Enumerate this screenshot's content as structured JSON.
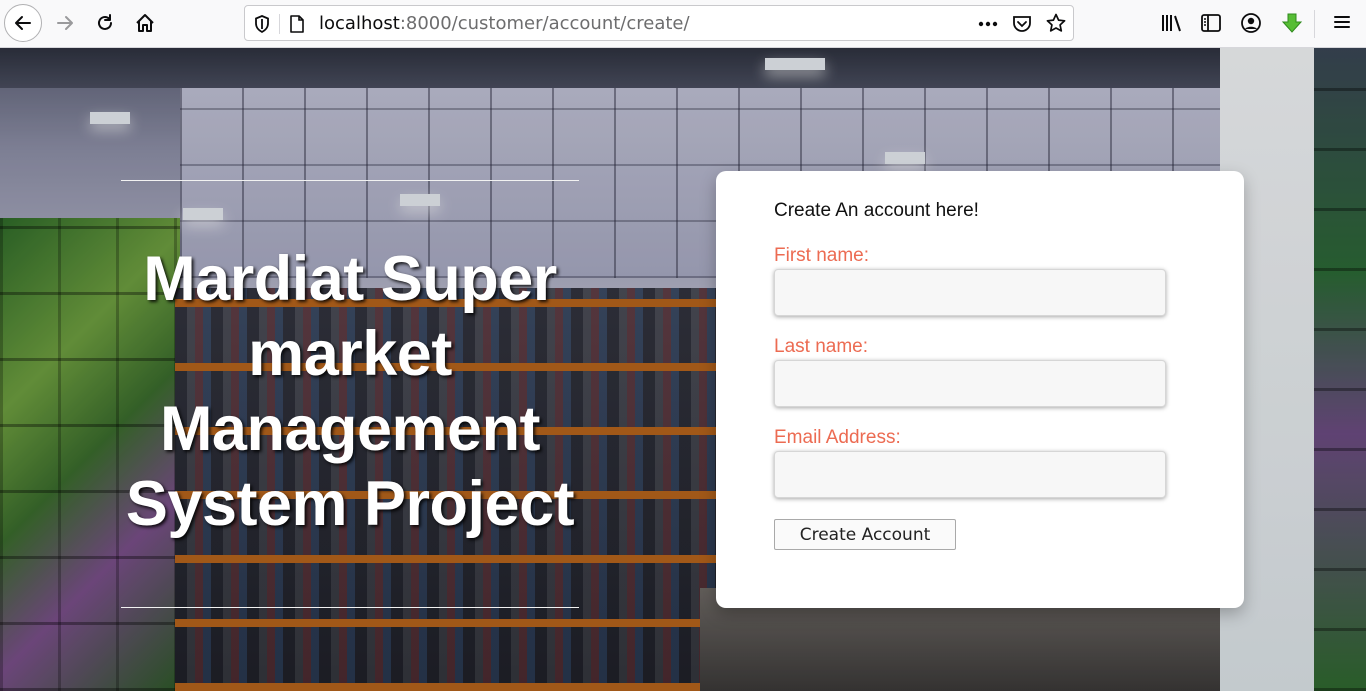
{
  "browser": {
    "url_host": "localhost",
    "url_rest": ":8000/customer/account/create/"
  },
  "hero": {
    "title_lines": [
      "Mardiat Super",
      "market",
      "Management",
      "System Project"
    ]
  },
  "form": {
    "heading": "Create An account here!",
    "first_name_label": "First name:",
    "first_name_value": "",
    "last_name_label": "Last name:",
    "last_name_value": "",
    "email_label": "Email Address:",
    "email_value": "",
    "submit_label": "Create Account"
  },
  "colors": {
    "label": "#ec6b52",
    "card_bg": "#ffffff",
    "hero_text": "#ffffff"
  },
  "icons": [
    "back-icon",
    "forward-icon",
    "reload-icon",
    "home-icon",
    "shield-icon",
    "page-icon",
    "page-actions-icon",
    "pocket-icon",
    "bookmark-star-icon",
    "library-icon",
    "sidebar-icon",
    "account-icon",
    "download-icon",
    "menu-icon"
  ]
}
